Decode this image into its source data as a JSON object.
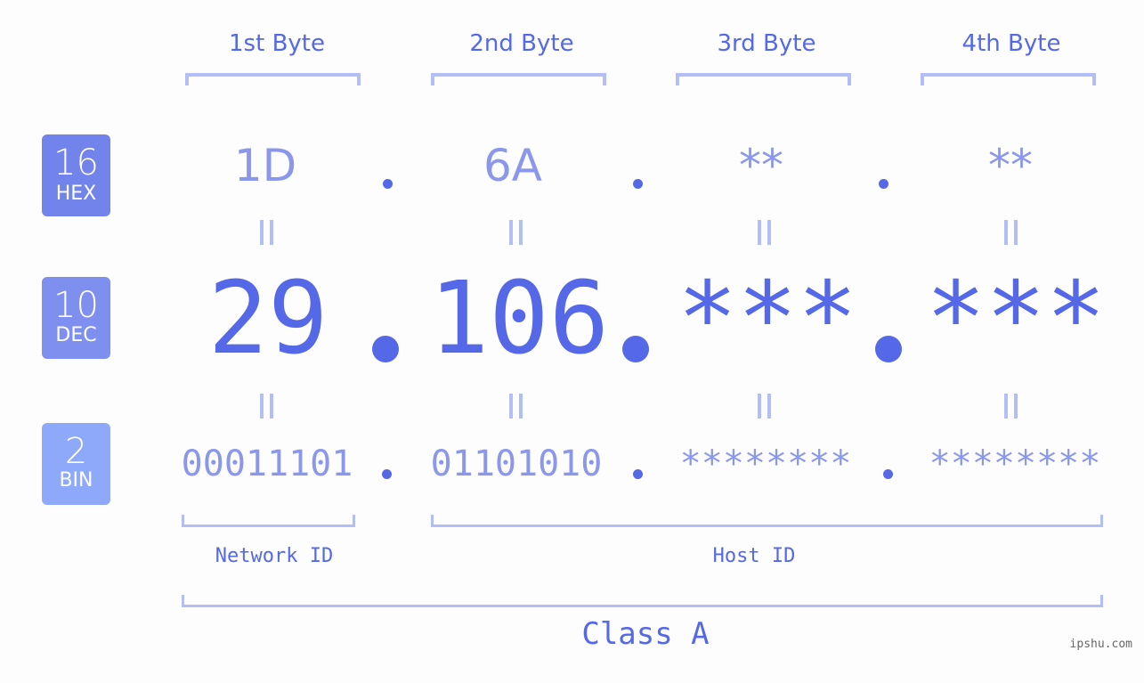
{
  "byte_headers": [
    "1st Byte",
    "2nd Byte",
    "3rd Byte",
    "4th Byte"
  ],
  "badges": {
    "hex": {
      "number": "16",
      "label": "HEX",
      "color": "#7283ec"
    },
    "dec": {
      "number": "10",
      "label": "DEC",
      "color": "#7f8ff0"
    },
    "bin": {
      "number": "2",
      "label": "BIN",
      "color": "#8ea8fa"
    }
  },
  "hex_values": [
    "1D",
    "6A",
    "**",
    "**"
  ],
  "dec_values": [
    "29",
    "106",
    "***",
    "***"
  ],
  "bin_values": [
    "00011101",
    "01101010",
    "********",
    "********"
  ],
  "separator": ".",
  "equals_symbol": "=",
  "labels": {
    "network_id": "Network ID",
    "host_id": "Host ID",
    "class": "Class A"
  },
  "watermark": "ipshu.com",
  "colors": {
    "primary": "#5468e8",
    "secondary": "#8a97ec",
    "bracket": "#b3bdf8",
    "background": "#fcfdfc"
  }
}
